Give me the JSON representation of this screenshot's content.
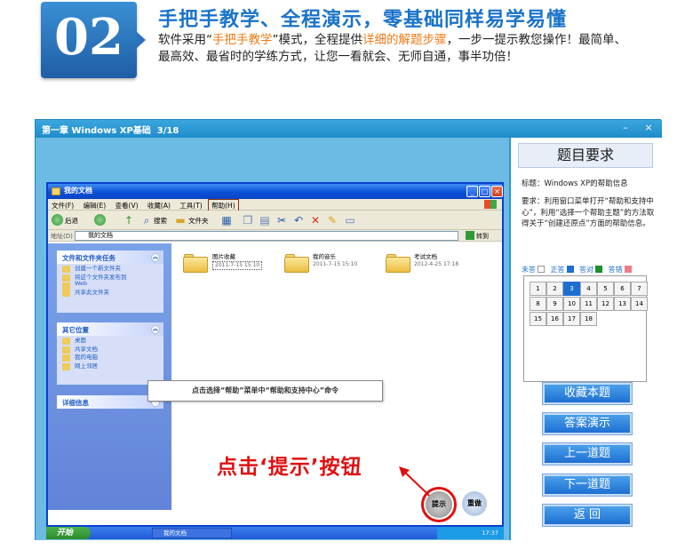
{
  "banner": {
    "number": "02",
    "title": "手把手教学、全程演示，零基础同样易学易懂",
    "desc_1": "软件采用“",
    "desc_hl1": "手把手教学",
    "desc_2": "”模式，全程提供",
    "desc_hl2": "详细的解题步骤",
    "desc_3": "，一步一提示教您操作！最简单、最高效、最省时的学练方式，让您一看就会、无师自通，事半功倍！"
  },
  "app": {
    "title": "第一章 Windows XP基础",
    "progress": "3/18",
    "minimize": "–",
    "close": "×"
  },
  "xp": {
    "title": "我的文档",
    "menu": [
      "文件(F)",
      "编辑(E)",
      "查看(V)",
      "收藏(A)",
      "工具(T)",
      "帮助(H)"
    ],
    "toolbar": {
      "back": "后退",
      "search": "搜索",
      "folders": "文件夹"
    },
    "address_label": "地址(D)",
    "address_value": "我的文档",
    "go": "转到",
    "tasks": {
      "file_tasks_title": "文件和文件夹任务",
      "file_tasks": [
        "创建一个新文件夹",
        "将这个文件夹发布到",
        "Web",
        "共享此文件夹"
      ],
      "other_places_title": "其它位置",
      "other_places": [
        "桌面",
        "共享文档",
        "我的电脑",
        "网上邻居"
      ],
      "details_title": "详细信息"
    },
    "folders": [
      {
        "name": "图片收藏",
        "date": "2011-7-15 15:10"
      },
      {
        "name": "我的音乐",
        "date": "2011-7-15 15:10"
      },
      {
        "name": "考试文档",
        "date": "2012-4-25 17:18"
      }
    ],
    "instruction": "点击选择“帮助”菜单中“帮助和支持中心”命令",
    "taskbar": {
      "start": "开始",
      "window": "我的文档",
      "clock": "17:37"
    }
  },
  "hint_text": "点击‘提示’按钮",
  "hint_button": "提示",
  "reset_button": "重做",
  "side": {
    "header": "题目要求",
    "title_line": "标题：Windows XP的帮助信息",
    "requirement": "要求：利用窗口菜单打开“帮助和支持中心”，利用“选择一个帮助主题”的方法取得关于“创建还原点”方面的帮助信息。",
    "legend": {
      "unanswered": "未答",
      "correct": "正答",
      "answered": "答对",
      "wrong": "答错"
    },
    "legend_colors": {
      "unanswered": "#ffffff",
      "correct": "#1c6fd0",
      "answered": "#1a8f2a",
      "wrong": "#f07b86"
    },
    "questions": [
      "1",
      "2",
      "3",
      "4",
      "5",
      "6",
      "7",
      "8",
      "9",
      "10",
      "11",
      "12",
      "13",
      "14",
      "15",
      "16",
      "17",
      "18"
    ],
    "current_question": "3",
    "buttons": [
      "收藏本题",
      "答案演示",
      "上一道题",
      "下一道题",
      "返 回"
    ]
  }
}
